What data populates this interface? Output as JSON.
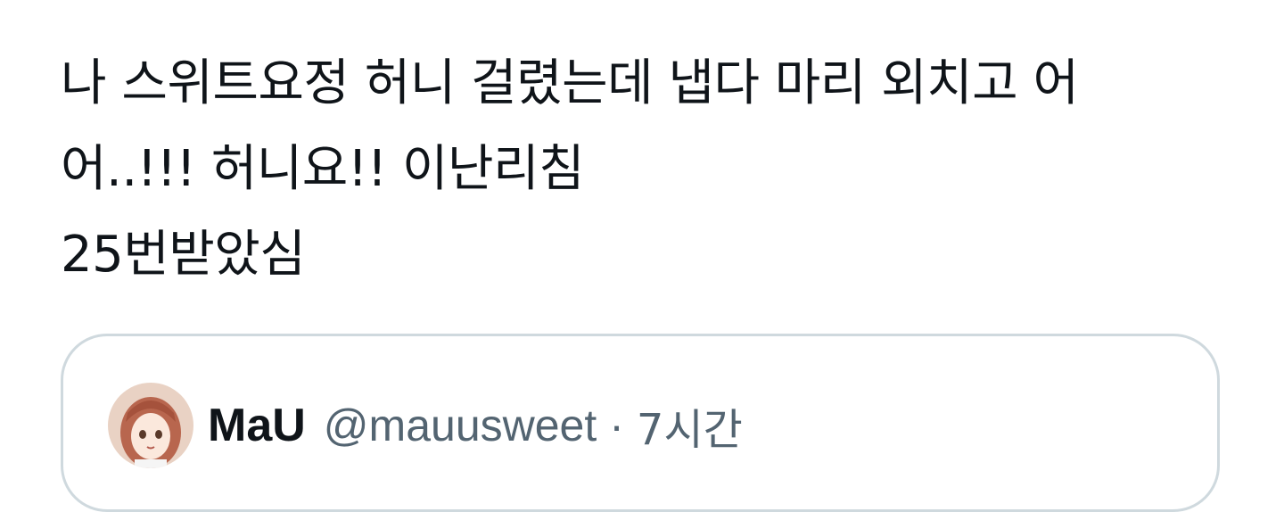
{
  "tweet": {
    "lines": [
      "나 스위트요정 허니 걸렸는데 냅다 마리 외치고 어",
      "어..!!! 허니요!! 이난리침",
      "25번받았심"
    ]
  },
  "quoted_tweet": {
    "author_name": "MaU",
    "author_handle": "@mauusweet",
    "separator": "·",
    "time_ago": "7시간",
    "avatar_icon": "anime-girl-avatar-icon"
  },
  "colors": {
    "text_primary": "#0f1419",
    "text_secondary": "#536471",
    "card_border": "#cfd9de"
  }
}
